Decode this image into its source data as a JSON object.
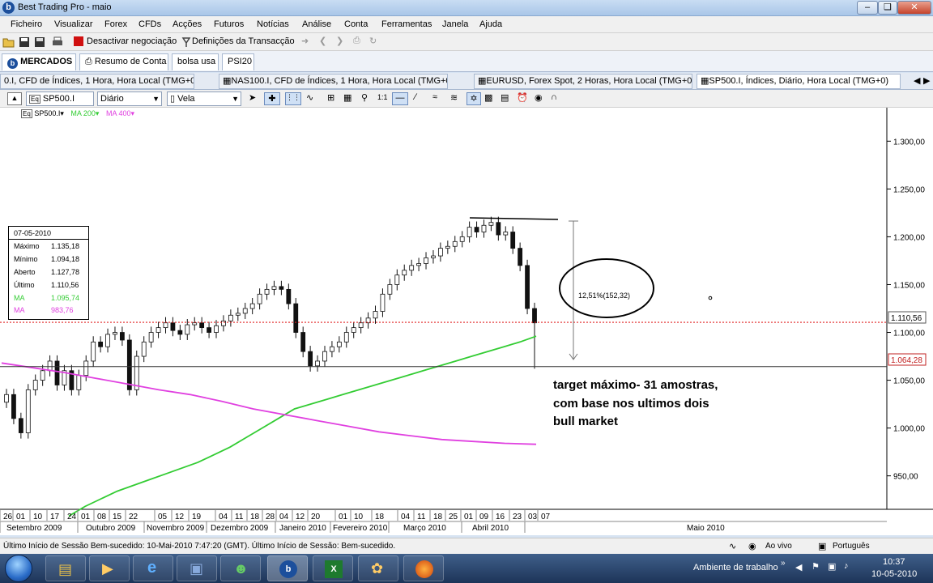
{
  "window": {
    "title": "Best Trading Pro - maio",
    "app_letter": "b"
  },
  "menu": [
    "Ficheiro",
    "Visualizar",
    "Forex",
    "CFDs",
    "Acções",
    "Futuros",
    "Notícias",
    "Análise",
    "Conta",
    "Ferramentas",
    "Janela",
    "Ajuda"
  ],
  "toolbar": {
    "deactivate_label": "Desactivar negociação",
    "transaction_label": "Definições da Transacção"
  },
  "main_tabs": [
    "MERCADOS",
    "Resumo de Conta",
    "bolsa usa",
    "PSI20"
  ],
  "chart_tabs": [
    "0.I, CFD de Índices, 1 Hora, Hora Local (TMG+0)",
    "NAS100.I, CFD de Índices, 1 Hora, Hora Local (TMG+0)",
    "EURUSD, Forex Spot, 2 Horas, Hora Local (TMG+0)",
    "SP500.I, Índices, Diário, Hora Local (TMG+0)"
  ],
  "chart_toolbar": {
    "symbol": "SP500.I",
    "period": "Diário",
    "chart_style": "Vela"
  },
  "legend": {
    "symbol": "SP500.I",
    "ma200": "MA 200",
    "ma400": "MA 400"
  },
  "info_box": {
    "date": "07-05-2010",
    "rows": [
      {
        "label": "Máximo",
        "value": "1.135,18"
      },
      {
        "label": "Mínimo",
        "value": "1.094,18"
      },
      {
        "label": "Aberto",
        "value": "1.127,78"
      },
      {
        "label": "Último",
        "value": "1.110,56"
      },
      {
        "label": "MA",
        "value": "1.095,74"
      },
      {
        "label": "MA",
        "value": "983,76"
      }
    ]
  },
  "price_labels": {
    "last": "1.110,56",
    "support": "1.064,28"
  },
  "annotation": {
    "percent": "12,51%(152,32)",
    "note_lines": [
      "target máximo- 31 amostras,",
      "com base nos ultimos dois",
      "bull market"
    ]
  },
  "colors": {
    "ma200": "#33cc33",
    "ma400": "#e040e0",
    "last_line": "#e02020",
    "candle_up": "#3a7a3a",
    "candle_down": "#111111"
  },
  "chart_data": {
    "type": "line",
    "y_ticks": [
      "1.300,00",
      "1.250,00",
      "1.200,00",
      "1.150,00",
      "1.100,00",
      "1.050,00",
      "1.000,00",
      "950,00"
    ],
    "y_tick_values": [
      1300,
      1250,
      1200,
      1150,
      1100,
      1050,
      1000,
      950
    ],
    "ylim": [
      915,
      1335
    ],
    "x_day_ticks": [
      "26",
      "01",
      "10",
      "17",
      "24",
      "01",
      "08",
      "15",
      "22",
      "05",
      "12",
      "19",
      "04",
      "11",
      "18",
      "28",
      "04",
      "12",
      "20",
      "01",
      "10",
      "18",
      "04",
      "11",
      "18",
      "25",
      "01",
      "09",
      "16",
      "23",
      "03",
      "07"
    ],
    "x_months": [
      "Setembro 2009",
      "Outubro 2009",
      "Novembro 2009",
      "Dezembro 2009",
      "Janeiro 2010",
      "Fevereiro 2010",
      "Março 2010",
      "Abril 2010",
      "Maio 2010"
    ],
    "price_close": [
      1035,
      1010,
      995,
      1040,
      1050,
      1060,
      1070,
      1045,
      1060,
      1040,
      1055,
      1070,
      1090,
      1085,
      1098,
      1100,
      1092,
      1040,
      1075,
      1090,
      1100,
      1105,
      1110,
      1102,
      1098,
      1108,
      1110,
      1105,
      1100,
      1107,
      1112,
      1118,
      1120,
      1125,
      1130,
      1140,
      1145,
      1148,
      1145,
      1130,
      1100,
      1080,
      1065,
      1070,
      1080,
      1085,
      1090,
      1100,
      1105,
      1110,
      1115,
      1122,
      1140,
      1150,
      1160,
      1165,
      1170,
      1172,
      1178,
      1180,
      1188,
      1190,
      1195,
      1200,
      1210,
      1205,
      1212,
      1215,
      1202,
      1205,
      1188,
      1170,
      1125,
      1110
    ],
    "ma200": [
      908,
      918,
      926,
      934,
      940,
      946,
      952,
      958,
      964,
      972,
      980,
      990,
      1000,
      1010,
      1020,
      1025,
      1030,
      1035,
      1040,
      1045,
      1050,
      1055,
      1060,
      1065,
      1070,
      1075,
      1080,
      1085,
      1090,
      1096
    ],
    "ma400": [
      1068,
      1063,
      1058,
      1052,
      1046,
      1040,
      1035,
      1028,
      1020,
      1014,
      1008,
      1002,
      996,
      992,
      988,
      986,
      984,
      983
    ],
    "support_level": 1064.28,
    "last_level": 1110.56,
    "peak_level": 1219
  }
}
